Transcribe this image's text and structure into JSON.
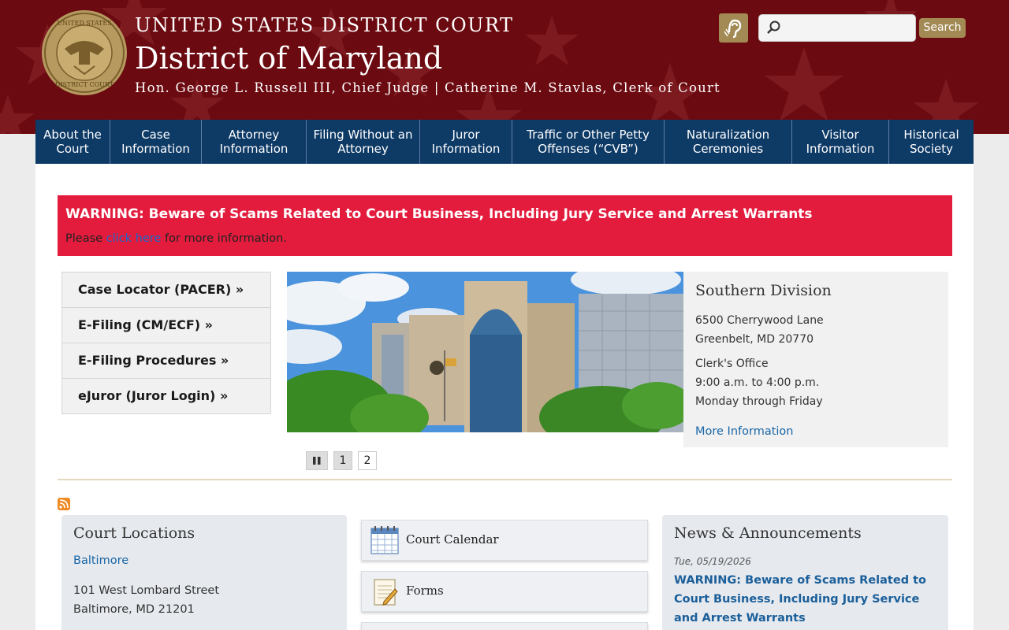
{
  "header": {
    "court_name": "UNITED STATES DISTRICT COURT",
    "district": "District of Maryland",
    "officials": "Hon. George L. Russell III, Chief Judge | Catherine M. Stavlas, Clerk of Court",
    "seal_icon": "court-seal-icon",
    "hearing_icon": "hearing-assistance-icon",
    "search_placeholder": "",
    "search_button": "Search"
  },
  "nav": {
    "items": [
      {
        "label": "About the Court"
      },
      {
        "label": "Case Information"
      },
      {
        "label": "Attorney Information"
      },
      {
        "label": "Filing Without an Attorney"
      },
      {
        "label": "Juror Information"
      },
      {
        "label": "Traffic or Other Petty Offenses (“CVB”)"
      },
      {
        "label": "Naturalization Ceremonies"
      },
      {
        "label": "Visitor Information"
      },
      {
        "label": "Historical Society"
      }
    ]
  },
  "alert": {
    "title": "WARNING: Beware of Scams Related to Court Business, Including Jury Service and Arrest Warrants",
    "text_before": "Please ",
    "link": "click here",
    "text_after": " for more information."
  },
  "quick_links": [
    {
      "label": "Case Locator (PACER) »"
    },
    {
      "label": "E-Filing (CM/ECF) »"
    },
    {
      "label": "E-Filing Procedures »"
    },
    {
      "label": "eJuror (Juror Login) »"
    }
  ],
  "slide": {
    "title": "Southern Division",
    "address1": "6500 Cherrywood Lane",
    "address2": "Greenbelt, MD 20770",
    "office": "Clerk's Office",
    "hours": "9:00 a.m. to 4:00 p.m.",
    "days": "Monday through Friday",
    "more": "More Information",
    "pages": [
      "1",
      "2"
    ],
    "active_page": "1"
  },
  "locations": {
    "title": "Court Locations",
    "city": "Baltimore",
    "address1": "101 West Lombard Street",
    "address2": "Baltimore, MD  21201"
  },
  "tiles": [
    {
      "label": "Court Calendar",
      "icon": "calendar-icon"
    },
    {
      "label": "Forms",
      "icon": "forms-icon"
    }
  ],
  "news": {
    "title": "News & Announcements",
    "date": "Tue, 05/19/2026",
    "headline": "WARNING: Beware of Scams Related to Court Business, Including Jury Service and Arrest Warrants"
  },
  "colors": {
    "header_bg": "#6b0a10",
    "nav_bg": "#0e3a66",
    "alert_bg": "#e31c3d",
    "gold": "#a38a55",
    "link": "#1a66a6"
  }
}
